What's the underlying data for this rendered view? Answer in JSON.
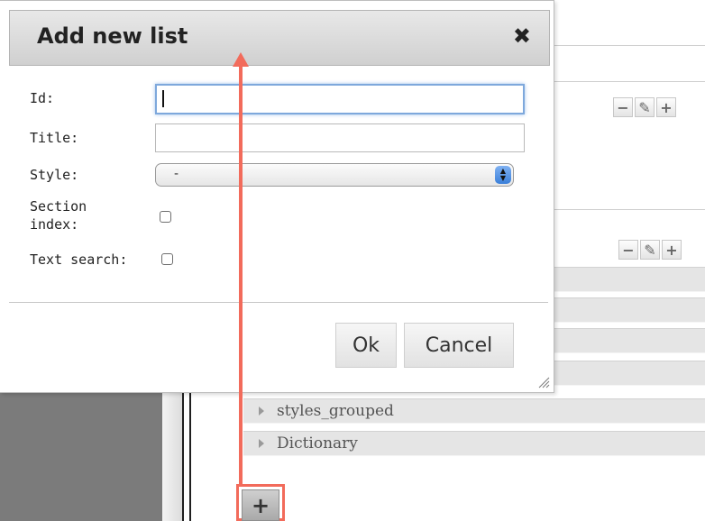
{
  "dialog": {
    "title": "Add new list",
    "close_icon": "close-icon",
    "fields": {
      "id_label": "Id:",
      "id_value": "",
      "title_label": "Title:",
      "title_value": "",
      "style_label": "Style:",
      "style_value": "-",
      "section_index_label_line1": "Section",
      "section_index_label_line2": "index:",
      "text_search_label": "Text search:"
    },
    "ok_label": "Ok",
    "cancel_label": "Cancel"
  },
  "background": {
    "lists": [
      "styles_grouped",
      "Dictionary"
    ],
    "add_button_label": "+",
    "toolbar_icons": [
      "minus-icon",
      "pencil-icon",
      "plus-icon"
    ]
  },
  "annotation": {
    "color": "#f26b5b"
  }
}
